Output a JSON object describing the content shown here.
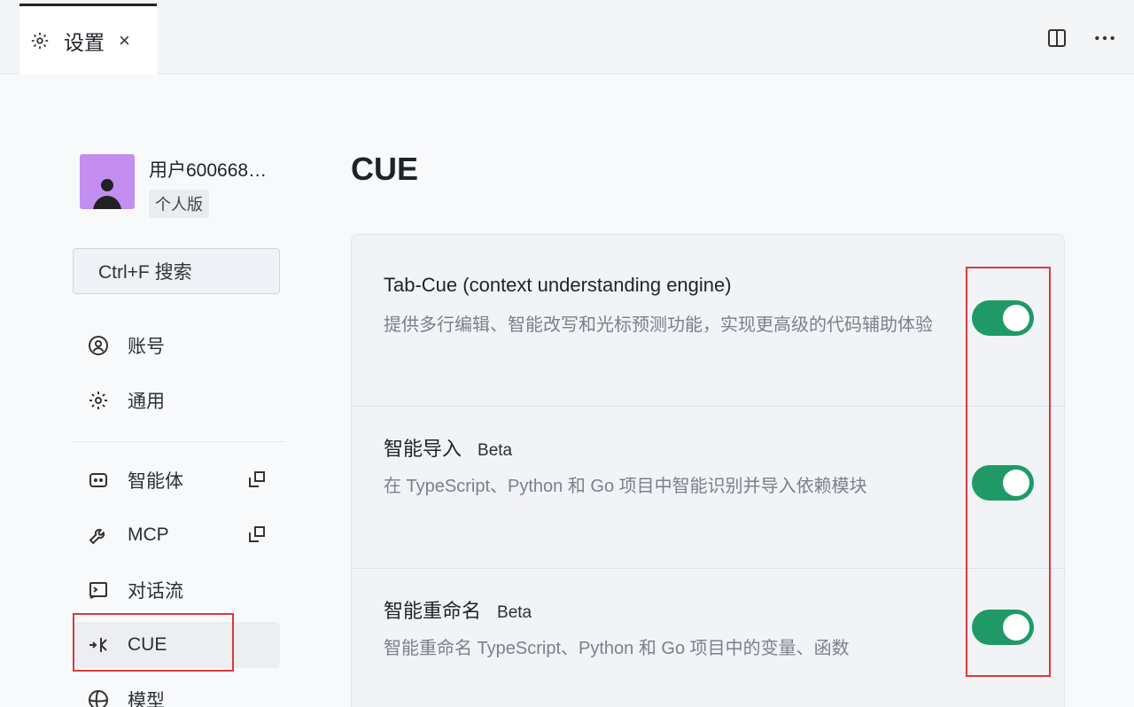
{
  "tab": {
    "title": "设置",
    "close": "×"
  },
  "sidebar": {
    "user_name": "用户600668…",
    "user_badge": "个人版",
    "search_label": "Ctrl+F 搜索",
    "items": [
      {
        "label": "账号",
        "icon": "user-circle-icon"
      },
      {
        "label": "通用",
        "icon": "gear-icon"
      },
      {
        "label": "智能体",
        "icon": "agent-icon",
        "external": true
      },
      {
        "label": "MCP",
        "icon": "wrench-icon",
        "external": true
      },
      {
        "label": "对话流",
        "icon": "terminal-icon"
      },
      {
        "label": "CUE",
        "icon": "cue-icon",
        "active": true
      },
      {
        "label": "模型",
        "icon": "model-icon"
      }
    ]
  },
  "main": {
    "title": "CUE",
    "settings": [
      {
        "title": "Tab-Cue (context understanding engine)",
        "beta": "",
        "description": "提供多行编辑、智能改写和光标预测功能，实现更高级的代码辅助体验",
        "enabled": true
      },
      {
        "title": "智能导入",
        "beta": "Beta",
        "description": "在 TypeScript、Python 和 Go 项目中智能识别并导入依赖模块",
        "enabled": true
      },
      {
        "title": "智能重命名",
        "beta": "Beta",
        "description": "智能重命名 TypeScript、Python 和 Go 项目中的变量、函数",
        "enabled": true
      }
    ]
  },
  "colors": {
    "toggle_on": "#1f9a66",
    "avatar": "#c48df0",
    "annotation": "#d93b3b"
  }
}
